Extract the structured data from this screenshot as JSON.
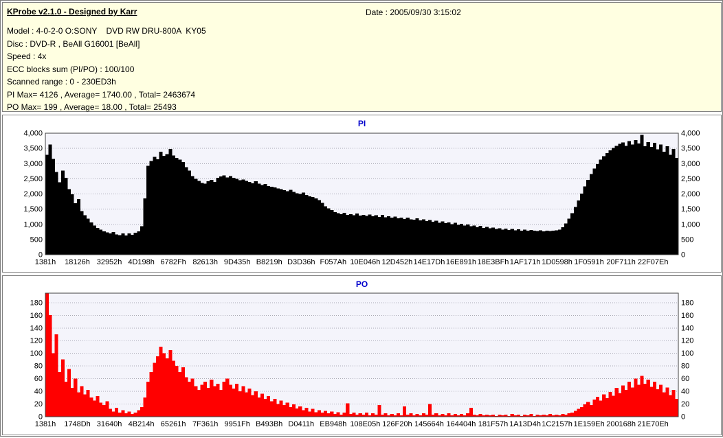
{
  "header": {
    "title": "KProbe v2.1.0 - Designed by Karr",
    "date": "Date : 2005/09/30 3:15:02",
    "info_lines": [
      "Model : 4-0-2-0 O:SONY    DVD RW DRU-800A  KY05",
      "Disc : DVD-R , BeAll G16001 [BeAll]",
      "Speed : 4x",
      "ECC blocks sum (PI/PO) : 100/100",
      "Scanned range : 0 - 230ED3h",
      "PI Max= 4126 , Average= 1740.00 , Total= 2463674",
      "PO Max= 199 , Average= 18.00 , Total= 25493"
    ]
  },
  "colors": {
    "header_bg": "#FFFFE1",
    "plot_bg": "#F4F4FB",
    "grid": "#A8A8B4",
    "frame": "#404040",
    "title_blue": "#0000CC",
    "pi_fill": "#000000",
    "po_fill": "#FF0000"
  },
  "chart_data": [
    {
      "type": "area",
      "title": "PI",
      "color": "#000000",
      "title_color": "#0000CC",
      "ylim": [
        0,
        4000
      ],
      "yticks": [
        0,
        500,
        1000,
        1500,
        2000,
        2500,
        3000,
        3500,
        4000
      ],
      "ytick_labels": [
        "0",
        "500",
        "1,000",
        "1,500",
        "2,000",
        "2,500",
        "3,000",
        "3,500",
        "4,000"
      ],
      "grid": true,
      "legend": "none",
      "x_labels": [
        "1381h",
        "18126h",
        "32952h",
        "4D198h",
        "6782Fh",
        "82613h",
        "9D435h",
        "B8219h",
        "D3D36h",
        "F057Ah",
        "10E046h",
        "12D452h",
        "14E17Dh",
        "16E891h",
        "18E3BFh",
        "1AF171h",
        "1D0598h",
        "1F0591h",
        "20F711h",
        "22F07Eh"
      ],
      "values": [
        3280,
        3620,
        3150,
        2720,
        2380,
        2760,
        2520,
        2150,
        1980,
        1690,
        1820,
        1430,
        1290,
        1180,
        1060,
        960,
        880,
        820,
        760,
        730,
        690,
        740,
        660,
        640,
        700,
        630,
        690,
        650,
        720,
        760,
        930,
        1850,
        2920,
        3080,
        3220,
        3140,
        3380,
        3250,
        3310,
        3470,
        3260,
        3180,
        3120,
        3050,
        2880,
        2760,
        2580,
        2490,
        2420,
        2360,
        2330,
        2410,
        2460,
        2390,
        2520,
        2570,
        2610,
        2540,
        2580,
        2530,
        2490,
        2450,
        2470,
        2420,
        2390,
        2350,
        2410,
        2330,
        2290,
        2320,
        2260,
        2230,
        2210,
        2180,
        2150,
        2120,
        2090,
        2130,
        2060,
        2020,
        1990,
        2040,
        1960,
        1920,
        1890,
        1850,
        1790,
        1700,
        1590,
        1520,
        1460,
        1400,
        1360,
        1330,
        1370,
        1310,
        1330,
        1290,
        1350,
        1280,
        1310,
        1270,
        1320,
        1260,
        1290,
        1240,
        1300,
        1230,
        1260,
        1210,
        1250,
        1190,
        1210,
        1170,
        1220,
        1160,
        1150,
        1190,
        1130,
        1160,
        1100,
        1140,
        1080,
        1110,
        1050,
        1090,
        1030,
        1060,
        1000,
        1040,
        980,
        1010,
        950,
        990,
        930,
        960,
        900,
        940,
        880,
        910,
        860,
        890,
        840,
        870,
        820,
        850,
        810,
        840,
        800,
        830,
        790,
        820,
        780,
        810,
        790,
        770,
        800,
        760,
        790,
        770,
        780,
        800,
        820,
        900,
        1020,
        1180,
        1360,
        1560,
        1780,
        2010,
        2240,
        2460,
        2650,
        2830,
        2980,
        3120,
        3240,
        3340,
        3430,
        3510,
        3580,
        3640,
        3690,
        3580,
        3730,
        3620,
        3770,
        3650,
        3940,
        3560,
        3700,
        3540,
        3680,
        3460,
        3620,
        3380,
        3560,
        3280,
        3480,
        3180
      ]
    },
    {
      "type": "area",
      "title": "PO",
      "color": "#FF0000",
      "title_color": "#0000CC",
      "ylim": [
        0,
        195
      ],
      "yticks": [
        0,
        20,
        40,
        60,
        80,
        100,
        120,
        140,
        160,
        180
      ],
      "ytick_labels": [
        "0",
        "20",
        "40",
        "60",
        "80",
        "100",
        "120",
        "140",
        "160",
        "180"
      ],
      "grid": true,
      "legend": "none",
      "x_labels": [
        "1381h",
        "1748Dh",
        "31640h",
        "4B214h",
        "65261h",
        "7F361h",
        "9951Fh",
        "B493Bh",
        "D0411h",
        "EB948h",
        "108E05h",
        "126F20h",
        "145664h",
        "164404h",
        "181F57h",
        "1A13D4h",
        "1C2157h",
        "1E159Eh",
        "200168h",
        "21E70Eh"
      ],
      "values": [
        195,
        160,
        100,
        130,
        70,
        90,
        55,
        75,
        45,
        60,
        38,
        48,
        35,
        42,
        30,
        25,
        32,
        22,
        18,
        24,
        12,
        8,
        14,
        6,
        10,
        5,
        8,
        4,
        6,
        10,
        15,
        30,
        55,
        70,
        85,
        95,
        110,
        100,
        92,
        105,
        88,
        80,
        70,
        78,
        62,
        55,
        60,
        48,
        42,
        50,
        55,
        45,
        58,
        48,
        52,
        42,
        55,
        60,
        50,
        44,
        52,
        40,
        48,
        38,
        44,
        34,
        40,
        30,
        36,
        28,
        32,
        24,
        28,
        20,
        25,
        18,
        22,
        15,
        19,
        13,
        16,
        10,
        14,
        8,
        12,
        7,
        10,
        6,
        9,
        5,
        8,
        4,
        7,
        3,
        6,
        21,
        4,
        6,
        3,
        5,
        3,
        6,
        2,
        5,
        3,
        18,
        3,
        5,
        2,
        4,
        2,
        5,
        2,
        16,
        3,
        5,
        2,
        4,
        2,
        5,
        3,
        20,
        3,
        5,
        2,
        4,
        2,
        5,
        2,
        4,
        2,
        4,
        2,
        5,
        14,
        3,
        2,
        4,
        2,
        3,
        2,
        3,
        1,
        3,
        2,
        3,
        1,
        4,
        2,
        3,
        1,
        3,
        2,
        4,
        1,
        3,
        2,
        3,
        2,
        4,
        2,
        3,
        2,
        4,
        3,
        5,
        6,
        9,
        12,
        15,
        19,
        23,
        18,
        27,
        31,
        25,
        35,
        29,
        39,
        33,
        45,
        37,
        49,
        42,
        55,
        46,
        60,
        50,
        64,
        52,
        58,
        47,
        55,
        43,
        50,
        38,
        46,
        34,
        42,
        28
      ]
    }
  ]
}
